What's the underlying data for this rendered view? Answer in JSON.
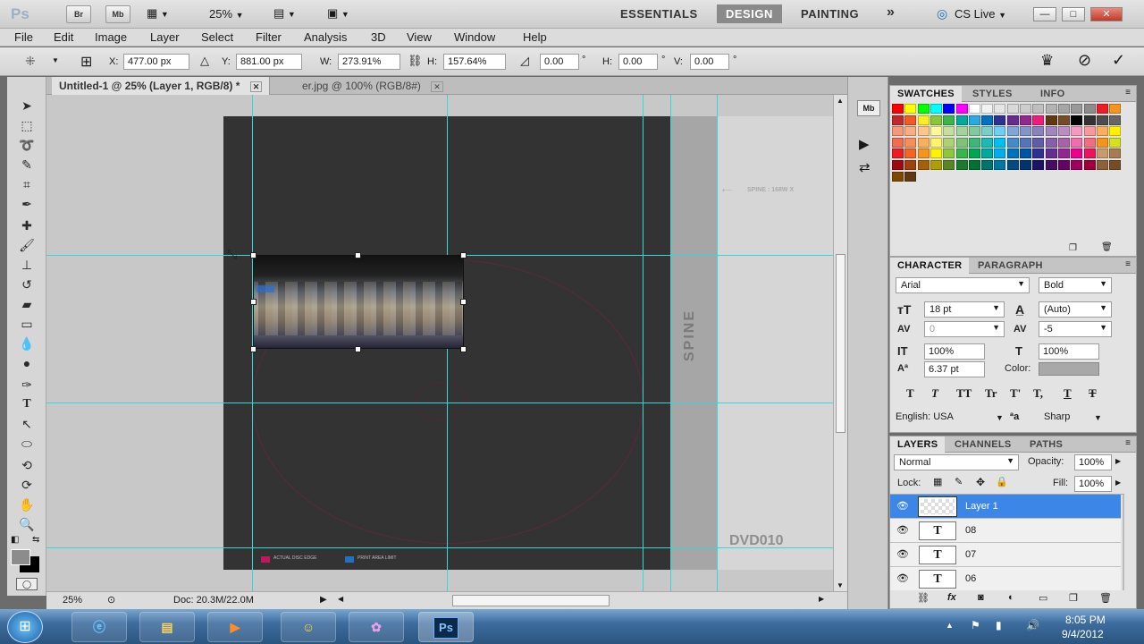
{
  "app": {
    "logo": "Ps",
    "bridge": "Br",
    "mini_bridge": "Mb",
    "zoom": "25%",
    "workspaces": [
      "ESSENTIALS",
      "DESIGN",
      "PAINTING"
    ],
    "active_workspace": "DESIGN",
    "more": "»",
    "cslive": "CS Live",
    "window_buttons": [
      "—",
      "□",
      "✕"
    ]
  },
  "menu": [
    "File",
    "Edit",
    "Image",
    "Layer",
    "Select",
    "Filter",
    "Analysis",
    "3D",
    "View",
    "Window",
    "Help"
  ],
  "options": {
    "x_label": "X:",
    "x_value": "477.00 px",
    "y_label": "Y:",
    "y_value": "881.00 px",
    "w_label": "W:",
    "w_value": "273.91%",
    "h_label": "H:",
    "h_value": "157.64%",
    "angle_value": "0.00",
    "deg1": "°",
    "hskew_label": "H:",
    "hskew_value": "0.00",
    "deg2": "°",
    "vskew_label": "V:",
    "vskew_value": "0.00",
    "deg3": "°"
  },
  "doc_tabs": [
    {
      "label": "Untitled-1 @ 25% (Layer 1, RGB/8) *",
      "active": true
    },
    {
      "label": "er.jpg @ 100% (RGB/8#)",
      "active": false
    }
  ],
  "canvas": {
    "spine": "SPINE",
    "spine_note": "SPINE : 168W X",
    "dvd_label": "DVD010",
    "legend_disc": "ACTUAL DISC EDGE",
    "legend_print": "PRINT AREA LIMIT",
    "colors": {
      "doc": "#333333",
      "spine": "#a6a6a6",
      "guide": "#38d6d6",
      "disc": "#c2185b",
      "print": "#1e73be"
    }
  },
  "status": {
    "zoom": "25%",
    "doc": "Doc: 20.3M/22.0M"
  },
  "swatches_panel": {
    "tabs": [
      "SWATCHES",
      "STYLES",
      "INFO"
    ],
    "colors": [
      "#ff0000",
      "#ffff00",
      "#00ff00",
      "#00ffff",
      "#0000ff",
      "#ff00ff",
      "#ffffff",
      "#f2f2f2",
      "#e6e6e6",
      "#d9d9d9",
      "#cccccc",
      "#bfbfbf",
      "#b3b3b3",
      "#a6a6a6",
      "#999999",
      "#8c8c8c",
      "#ee1c24",
      "#f7941d",
      "#c1272d",
      "#f15a24",
      "#fcee21",
      "#8cc63f",
      "#39b54a",
      "#00a99d",
      "#29abe2",
      "#0071bc",
      "#2e3192",
      "#662d91",
      "#93278f",
      "#ed1e79",
      "#603813",
      "#754c24",
      "#000000",
      "#333333",
      "#4d4d4d",
      "#666666",
      "#f7977a",
      "#f9ad81",
      "#fdc68a",
      "#fff79a",
      "#c4df9b",
      "#a2d39c",
      "#82ca9d",
      "#7bcdc8",
      "#6ecff6",
      "#7ea7d8",
      "#8493ca",
      "#8882be",
      "#a187be",
      "#bc8dbf",
      "#f49ac2",
      "#f6989d",
      "#fbaf5d",
      "#fff200",
      "#f26c4f",
      "#f68e55",
      "#fbaf5c",
      "#fff467",
      "#acd372",
      "#7cc576",
      "#3bb878",
      "#1abbb4",
      "#00bff3",
      "#438ccb",
      "#5574b9",
      "#605ca8",
      "#855fa8",
      "#a763a8",
      "#f06eaa",
      "#f26d7d",
      "#f7941d",
      "#d7df23",
      "#ed1c24",
      "#f26522",
      "#f7941d",
      "#fff200",
      "#8dc63f",
      "#39b54a",
      "#00a651",
      "#00a99d",
      "#00aeef",
      "#0072bc",
      "#0054a6",
      "#2e3192",
      "#662d91",
      "#92278f",
      "#ec008c",
      "#ed145b",
      "#c69c6d",
      "#a67c52",
      "#9e0b0f",
      "#a0410d",
      "#a36209",
      "#aba000",
      "#598527",
      "#1a7b30",
      "#007236",
      "#00746b",
      "#0076a3",
      "#004b80",
      "#003471",
      "#1b1464",
      "#440e62",
      "#630460",
      "#9e005d",
      "#9e0039",
      "#8c6239",
      "#754c24",
      "#7d4900",
      "#603913"
    ]
  },
  "character_panel": {
    "tabs": [
      "CHARACTER",
      "PARAGRAPH"
    ],
    "font": "Arial",
    "style": "Bold",
    "size": "18 pt",
    "leading": "(Auto)",
    "kerning": "0",
    "tracking": "-5",
    "v_scale": "100%",
    "h_scale": "100%",
    "baseline": "6.37 pt",
    "color_label": "Color:",
    "styles": [
      "T",
      "T",
      "TT",
      "Tr",
      "T'",
      "T,",
      "T",
      "T"
    ],
    "language": "English: USA",
    "aa_label": "a",
    "aa": "Sharp"
  },
  "layers_panel": {
    "tabs": [
      "LAYERS",
      "CHANNELS",
      "PATHS"
    ],
    "blend": "Normal",
    "opacity_label": "Opacity:",
    "opacity": "100%",
    "lock_label": "Lock:",
    "fill_label": "Fill:",
    "fill": "100%",
    "layers": [
      {
        "name": "Layer 1",
        "type": "image",
        "selected": true
      },
      {
        "name": "08",
        "type": "text",
        "selected": false
      },
      {
        "name": "07",
        "type": "text",
        "selected": false
      },
      {
        "name": "06",
        "type": "text",
        "selected": false
      }
    ],
    "text_thumb": "T"
  },
  "taskbar": {
    "time": "8:05 PM",
    "date": "9/4/2012",
    "ps_label": "Ps"
  }
}
